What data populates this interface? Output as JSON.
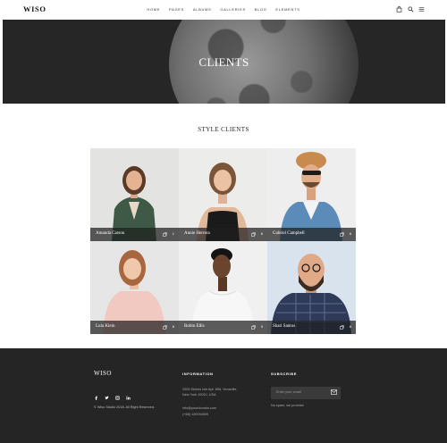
{
  "header": {
    "logo": "WISO",
    "nav": [
      "HOME",
      "PAGES",
      "ALBUMS",
      "GALLERIES",
      "BLOG",
      "ELEMENTS"
    ]
  },
  "hero": {
    "title": "CLIENTS"
  },
  "section": {
    "title": "STYLE CLIENTS"
  },
  "clients": [
    {
      "name": "Amanda Carson",
      "count": "1"
    },
    {
      "name": "Annie Herrera",
      "count": "6"
    },
    {
      "name": "Gabriel Campbell",
      "count": "6"
    },
    {
      "name": "Lula Klein",
      "count": "6"
    },
    {
      "name": "Robin Ellis",
      "count": "3"
    },
    {
      "name": "Shari Santos",
      "count": "6"
    }
  ],
  "footer": {
    "logo": "WISO",
    "copyright": "© Wiso Studio 2018. All Right Reserved.",
    "info_heading": "INFORMATION",
    "address_line1": "2005 Stokes Isle Apt. 896, Venaville,",
    "address_line2": "New York 10010, USA",
    "email": "info@yourdomain.com",
    "phone": "(+68) 120034509",
    "subscribe_heading": "SUBSCRIBE",
    "subscribe_placeholder": "Enter your email",
    "subscribe_note": "No spam, we promise"
  },
  "colors": {
    "dark": "#252525",
    "hero": "#262626",
    "accent": "#ffffff"
  },
  "icons": [
    "cart-icon",
    "search-icon",
    "menu-icon",
    "photos-icon",
    "mail-icon",
    "facebook-icon",
    "twitter-icon",
    "instagram-icon",
    "linkedin-icon"
  ]
}
